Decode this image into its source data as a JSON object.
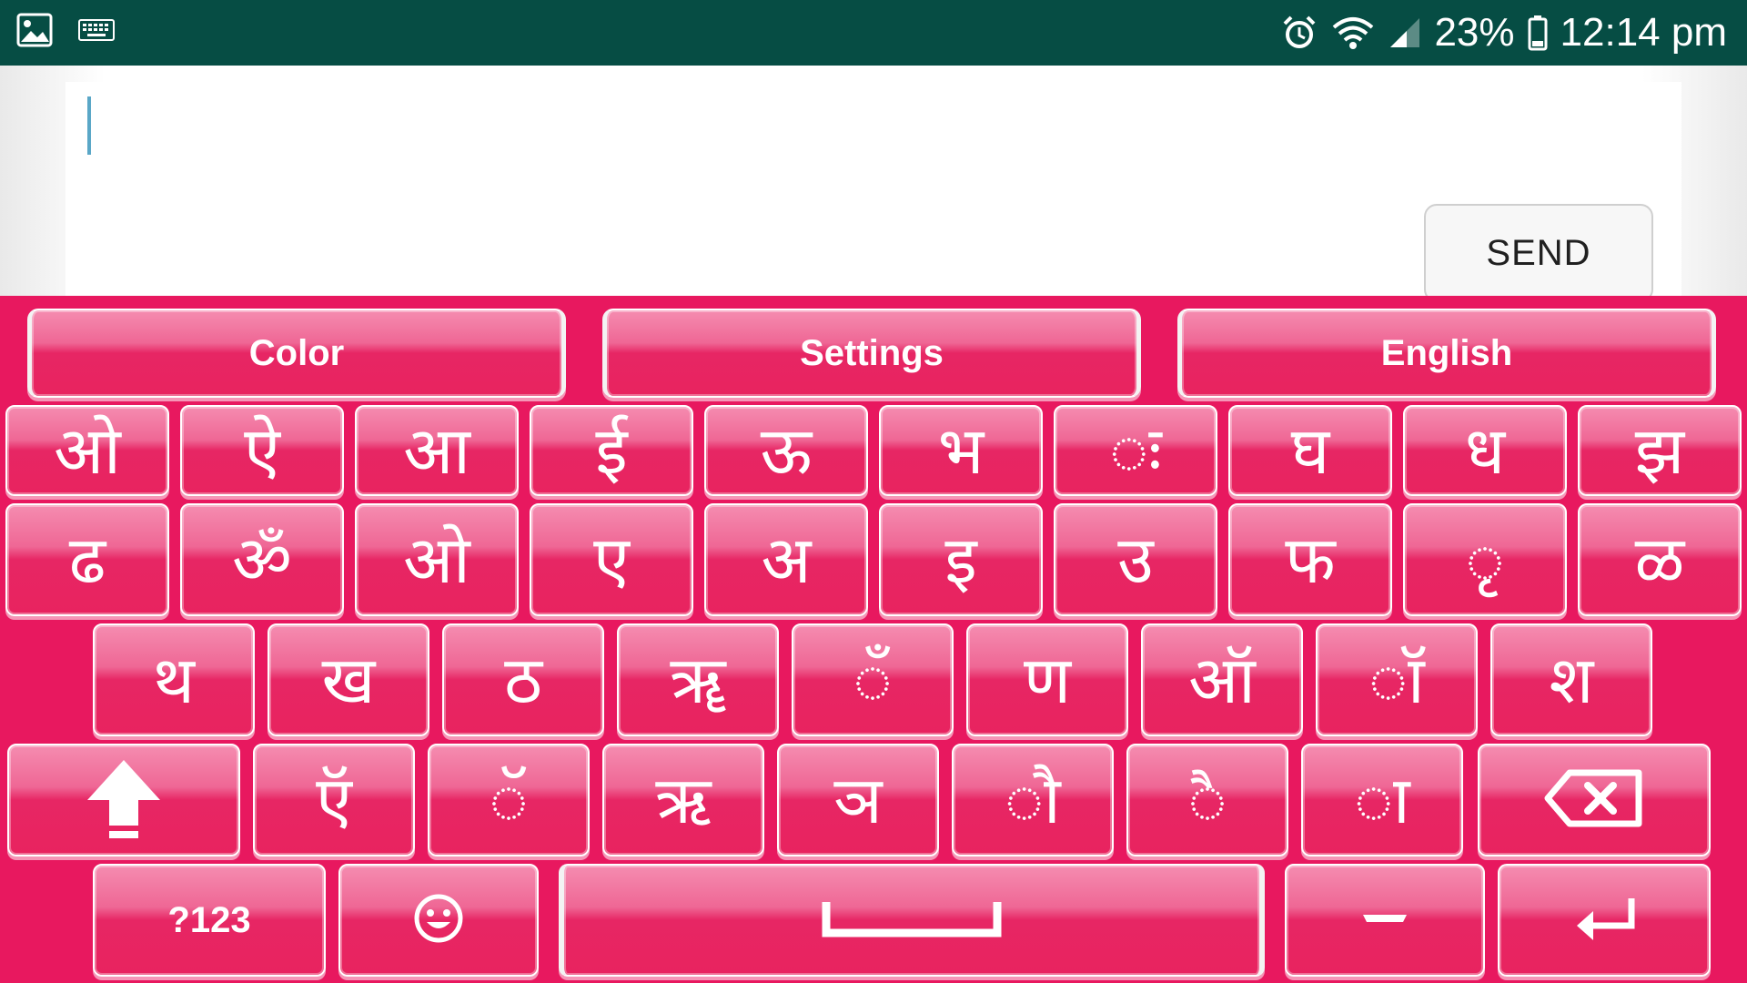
{
  "status_bar": {
    "left_icons": [
      "image-icon",
      "keyboard-icon"
    ],
    "battery_percent": "23%",
    "time": "12:14 pm",
    "right_icons": [
      "alarm-icon",
      "wifi-icon",
      "signal-icon",
      "battery-icon"
    ]
  },
  "compose": {
    "input_value": "",
    "send_label": "SEND"
  },
  "keyboard": {
    "top_bar": [
      "Color",
      "Settings",
      "English"
    ],
    "row1": [
      "ओ",
      "ऐ",
      "आ",
      "ई",
      "ऊ",
      "भ",
      "ः",
      "घ",
      "ध",
      "झ"
    ],
    "row2": [
      "ढ",
      "ॐ",
      "ओ",
      "ए",
      "अ",
      "इ",
      "उ",
      "फ",
      "ृ",
      "ळ"
    ],
    "row3": [
      "थ",
      "ख",
      "ठ",
      "ॠ",
      "ँ",
      "ण",
      "ऑ",
      "ॉ",
      "श"
    ],
    "row4": [
      "ऍ",
      "ॅ",
      "ऋ",
      "ञ",
      "ौ",
      "ै",
      "ा"
    ],
    "numbers_label": "?123",
    "colors": {
      "keyboard_bg": "#e8185f",
      "status_bar_bg": "#064d44"
    }
  }
}
